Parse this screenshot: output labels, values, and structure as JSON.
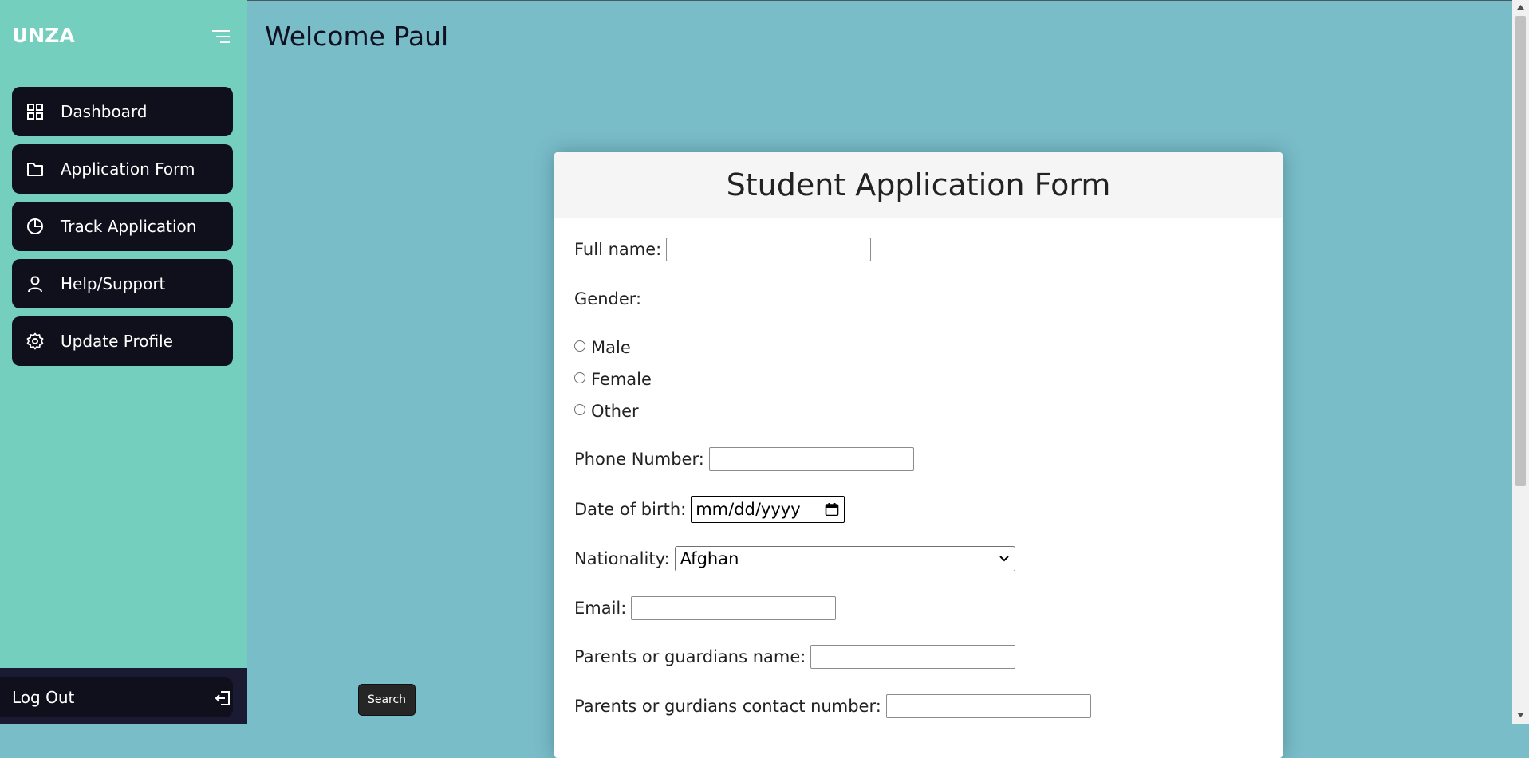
{
  "brand": "UNZA",
  "sidebar": {
    "items": [
      {
        "label": "Dashboard",
        "icon": "grid-icon"
      },
      {
        "label": "Application Form",
        "icon": "folder-icon"
      },
      {
        "label": "Track Application",
        "icon": "pie-chart-icon"
      },
      {
        "label": "Help/Support",
        "icon": "user-icon"
      },
      {
        "label": "Update Profile",
        "icon": "gear-icon"
      }
    ],
    "logout_label": "Log Out"
  },
  "header": {
    "welcome": "Welcome Paul"
  },
  "search_button": "Search",
  "form": {
    "title": "Student Application Form",
    "full_name_label": "Full name:",
    "gender_label": "Gender:",
    "gender_options": [
      "Male",
      "Female",
      "Other"
    ],
    "phone_label": "Phone Number:",
    "dob_label": "Date of birth:",
    "dob_placeholder": "mm/dd/yyyy",
    "nationality_label": "Nationality:",
    "nationality_value": "Afghan",
    "email_label": "Email:",
    "guardian_name_label": "Parents or guardians name:",
    "guardian_contact_label": "Parents or gurdians contact number:"
  },
  "colors": {
    "sidebar_bg": "#75cfbf",
    "main_bg": "#79bdc9",
    "nav_item_bg": "#0f101c",
    "logout_bar_bg": "#1b1a33"
  }
}
